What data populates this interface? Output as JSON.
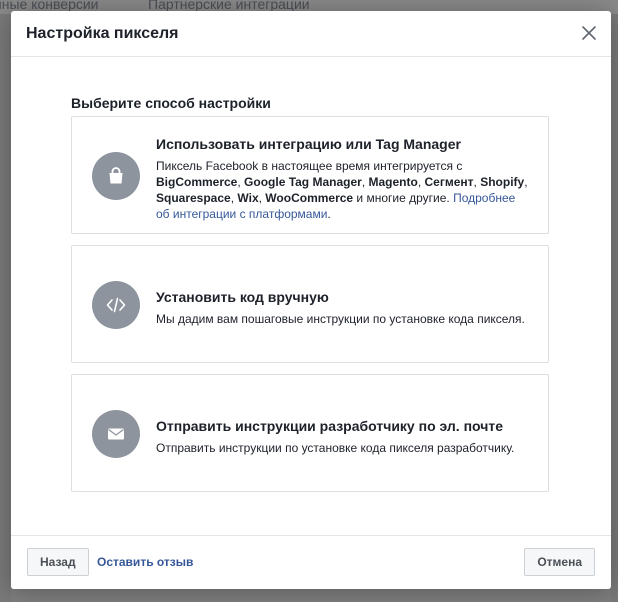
{
  "background": {
    "tabs": [
      "нные конверсии",
      "Партнерские интеграции"
    ]
  },
  "modal": {
    "title": "Настройка пикселя"
  },
  "body": {
    "section_title": "Выберите способ настройки",
    "options": [
      {
        "icon": "shopping-bag-icon",
        "title": "Использовать интеграцию или Tag Manager",
        "desc_parts": [
          {
            "text": "Пиксель Facebook в настоящее время интегрируется с ",
            "style": "normal"
          },
          {
            "text": "BigCommerce",
            "style": "bold"
          },
          {
            "text": ", ",
            "style": "normal"
          },
          {
            "text": "Google Tag Manager",
            "style": "bold"
          },
          {
            "text": ", ",
            "style": "normal"
          },
          {
            "text": "Magento",
            "style": "bold"
          },
          {
            "text": ", ",
            "style": "normal"
          },
          {
            "text": "Сегмент",
            "style": "bold"
          },
          {
            "text": ", ",
            "style": "normal"
          },
          {
            "text": "Shopify",
            "style": "bold"
          },
          {
            "text": ", ",
            "style": "normal"
          },
          {
            "text": "Squarespace",
            "style": "bold"
          },
          {
            "text": ", ",
            "style": "normal"
          },
          {
            "text": "Wix",
            "style": "bold"
          },
          {
            "text": ", ",
            "style": "normal"
          },
          {
            "text": "WooCommerce",
            "style": "bold"
          },
          {
            "text": " и многие другие. ",
            "style": "normal"
          },
          {
            "text": "Подробнее об интеграции с платформами",
            "style": "link"
          },
          {
            "text": ".",
            "style": "normal"
          }
        ]
      },
      {
        "icon": "code-icon",
        "title": "Установить код вручную",
        "desc": "Мы дадим вам пошаговые инструкции по установке кода пикселя."
      },
      {
        "icon": "envelope-icon",
        "title": "Отправить инструкции разработчику по эл. почте",
        "desc": "Отправить инструкции по установке кода пикселя разработчику."
      }
    ]
  },
  "footer": {
    "back_label": "Назад",
    "feedback_label": "Оставить отзыв",
    "cancel_label": "Отмена"
  },
  "colors": {
    "link": "#365899",
    "icon_circle": "#8d949e",
    "border": "#dddfe2"
  }
}
